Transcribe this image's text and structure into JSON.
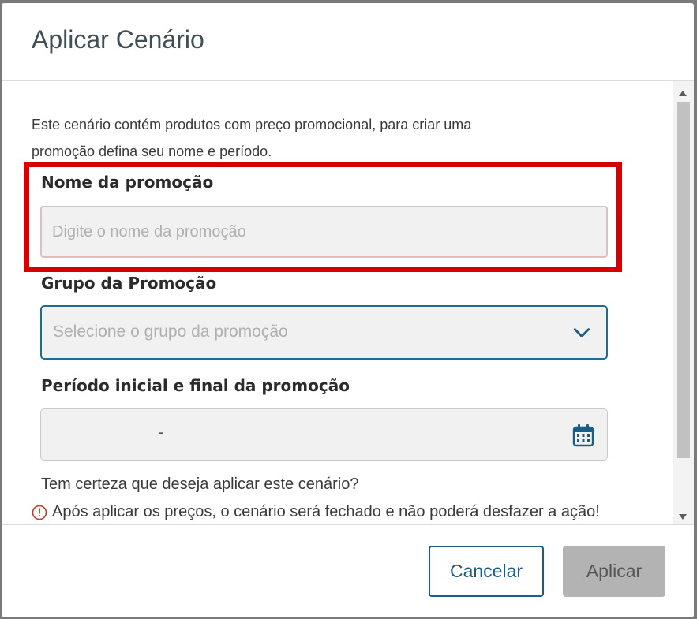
{
  "modal": {
    "title": "Aplicar Cenário"
  },
  "body": {
    "description": "Este cenário contém produtos com preço promocional, para criar uma promoção defina seu nome e período.",
    "promo_name": {
      "label": "Nome da promoção",
      "value": "",
      "placeholder": "Digite o nome da promoção"
    },
    "promo_group": {
      "label": "Grupo da Promoção",
      "placeholder": "Selecione o grupo da promoção",
      "icon": "chevron-down-icon"
    },
    "promo_period": {
      "label": "Período inicial e final da promoção",
      "separator": "-",
      "icon": "calendar-icon"
    },
    "confirm_question": "Tem certeza que deseja aplicar este cenário?",
    "warning_text": "Após aplicar os preços, o cenário será fechado e não poderá desfazer a ação!",
    "warning_icon": "exclamation-circle-icon"
  },
  "footer": {
    "cancel_label": "Cancelar",
    "apply_label": "Aplicar"
  },
  "colors": {
    "accent": "#1b5e85",
    "highlight": "#d50000",
    "warning_icon": "#c0392b",
    "disabled_button": "#b3b3b3"
  }
}
